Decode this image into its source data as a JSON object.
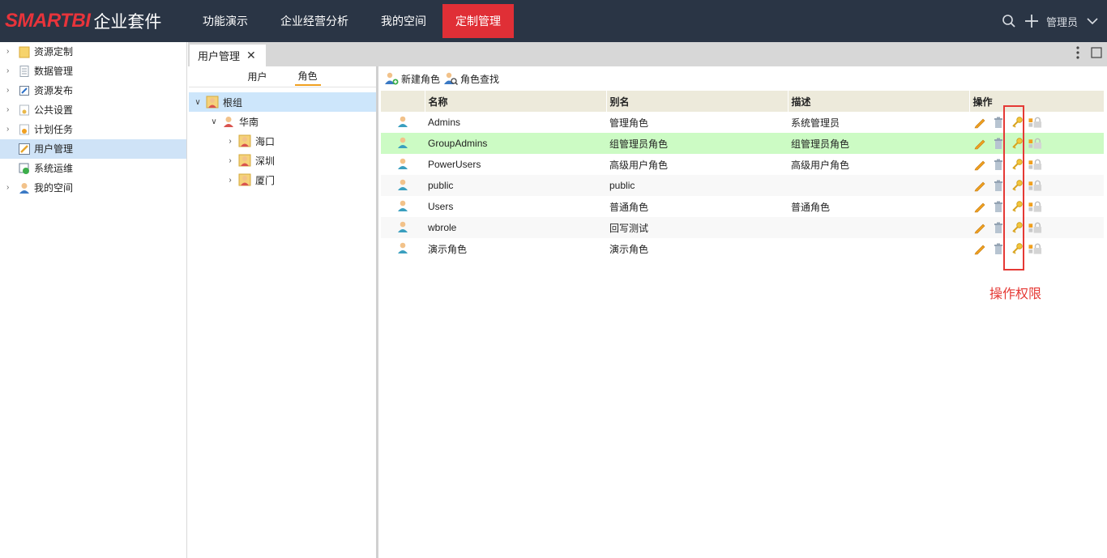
{
  "header": {
    "logo_brand": "SMARTBI",
    "logo_suite": "企业套件",
    "nav": [
      "功能演示",
      "企业经营分析",
      "我的空间",
      "定制管理"
    ],
    "active_nav": "定制管理",
    "user": "管理员"
  },
  "sidebar": {
    "items": [
      {
        "label": "资源定制",
        "icon": "folder-icon"
      },
      {
        "label": "数据管理",
        "icon": "document-icon"
      },
      {
        "label": "资源发布",
        "icon": "publish-icon"
      },
      {
        "label": "公共设置",
        "icon": "settings-folder-icon"
      },
      {
        "label": "计划任务",
        "icon": "schedule-icon"
      },
      {
        "label": "用户管理",
        "icon": "user-management-icon"
      },
      {
        "label": "系统运维",
        "icon": "system-ops-icon"
      },
      {
        "label": "我的空间",
        "icon": "user-icon"
      }
    ],
    "selected": "用户管理"
  },
  "tab": {
    "label": "用户管理"
  },
  "subtabs": [
    "用户",
    "角色"
  ],
  "active_subtab": "角色",
  "tree": {
    "root": "根组",
    "child": "华南",
    "leaves": [
      "海口",
      "深圳",
      "厦门"
    ]
  },
  "toolbar": {
    "new_role": "新建角色",
    "find_role": "角色查找"
  },
  "grid": {
    "columns": [
      "名称",
      "别名",
      "描述",
      "操作"
    ],
    "rows": [
      {
        "name": "Admins",
        "alias": "管理角色",
        "desc": "系统管理员"
      },
      {
        "name": "GroupAdmins",
        "alias": "组管理员角色",
        "desc": "组管理员角色"
      },
      {
        "name": "PowerUsers",
        "alias": "高级用户角色",
        "desc": "高级用户角色"
      },
      {
        "name": "public",
        "alias": "public",
        "desc": ""
      },
      {
        "name": "Users",
        "alias": "普通角色",
        "desc": "普通角色"
      },
      {
        "name": "wbrole",
        "alias": "回写测试",
        "desc": ""
      },
      {
        "name": "演示角色",
        "alias": "演示角色",
        "desc": ""
      }
    ],
    "highlighted_row": "GroupAdmins"
  },
  "annotation": {
    "text": "操作权限",
    "color": "#e53935"
  }
}
